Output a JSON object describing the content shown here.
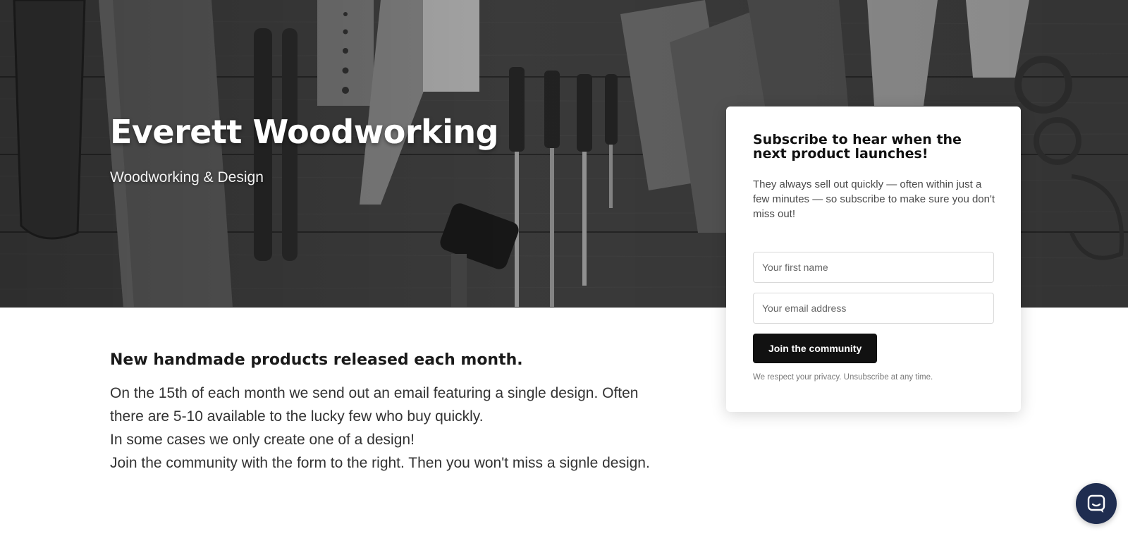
{
  "hero": {
    "title": "Everett Woodworking",
    "subtitle": "Woodworking & Design",
    "background_image": "workshop-tools-photo"
  },
  "content": {
    "heading": "New handmade products released each month.",
    "lines": [
      "On the 15th of each month we send out an email featuring a single design. Often",
      "there are 5-10 available to the lucky few who buy quickly.",
      "In some cases we only create one of a design!",
      "Join the community with the form to the right. Then you won't miss a signle design."
    ]
  },
  "subscribe": {
    "title": "Subscribe to hear when the next product launches!",
    "description": "They always sell out quickly — often within just a few minutes — so subscribe to make sure you don't miss out!",
    "first_name_placeholder": "Your first name",
    "email_placeholder": "Your email address",
    "button_label": "Join the community",
    "privacy_note": "We respect your privacy. Unsubscribe at any time."
  },
  "chat": {
    "icon": "chat-bubble-icon"
  },
  "colors": {
    "button_bg": "#111111",
    "chat_bg": "#1f2d50",
    "text_dark": "#1a1a1a"
  }
}
